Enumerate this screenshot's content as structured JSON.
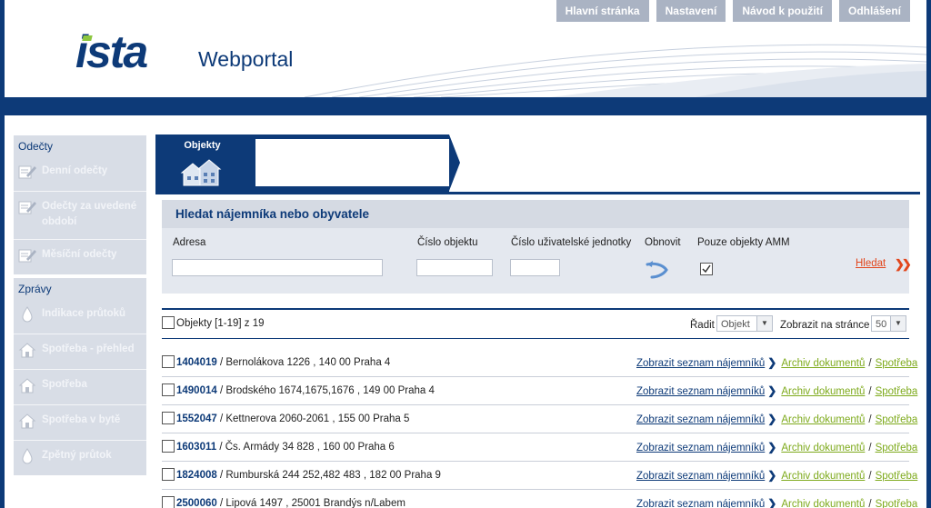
{
  "header": {
    "logo_text": "ista",
    "product": "Webportal",
    "nav": [
      "Hlavní stránka",
      "Nastavení",
      "Návod k použití",
      "Odhlášení"
    ]
  },
  "sidebar": {
    "groups": [
      {
        "title": "Odečty",
        "items": [
          {
            "label": "Denní odečty",
            "icon": "pencil-icon"
          },
          {
            "label": "Odečty za uvedené období",
            "icon": "pencil-icon"
          },
          {
            "label": "Měsíční odečty",
            "icon": "pencil-icon"
          }
        ]
      },
      {
        "title": "Zprávy",
        "items": [
          {
            "label": "Indikace průtoků",
            "icon": "drop-icon"
          },
          {
            "label": "Spotřeba - přehled",
            "icon": "house-icon"
          },
          {
            "label": "Spotřeba",
            "icon": "house-icon"
          },
          {
            "label": "Spotřeba v bytě",
            "icon": "house-icon"
          },
          {
            "label": "Zpětný průtok",
            "icon": "drop-icon"
          }
        ]
      }
    ]
  },
  "tab": {
    "label": "Objekty",
    "icon": "buildings-icon"
  },
  "search": {
    "title": "Hledat nájemníka nebo obyvatele",
    "fields": {
      "adresa": {
        "label": "Adresa",
        "value": ""
      },
      "cislo_objektu": {
        "label": "Číslo objektu",
        "value": ""
      },
      "cislo_jednotky": {
        "label": "Číslo uživatelské jednotky",
        "value": ""
      }
    },
    "refresh_label": "Obnovit",
    "amm_label": "Pouze objekty AMM",
    "amm_checked": true,
    "search_button": "Hledat"
  },
  "list": {
    "count_text": "Objekty [1-19] z 19",
    "sort_label": "Řadit",
    "sort_value": "Objekt",
    "page_size_label": "Zobrazit na stránce",
    "page_size_value": "50",
    "action_labels": {
      "tenants": "Zobrazit seznam nájemníků",
      "archive": "Archiv dokumentů",
      "consumption": "Spotřeba",
      "separator": "/"
    },
    "rows": [
      {
        "id": "1404019",
        "address": " / Bernolákova 1226 , 140 00 Praha 4"
      },
      {
        "id": "1490014",
        "address": " / Brodského 1674,1675,1676 , 149 00 Praha 4"
      },
      {
        "id": "1552047",
        "address": " / Kettnerova 2060-2061 , 155 00 Praha 5"
      },
      {
        "id": "1603011",
        "address": " / Čs. Armády 34 828 , 160 00 Praha 6"
      },
      {
        "id": "1824008",
        "address": " / Rumburská 244 252,482 483 , 182 00 Praha 9"
      },
      {
        "id": "2500060",
        "address": " / Lipová 1497 , 25001 Brandýs n/Labem"
      }
    ]
  },
  "colors": {
    "brand_navy": "#0d3a78",
    "link_green": "#7eaa1c",
    "search_red": "#e2461c",
    "topnav_gray": "#aab3c3"
  }
}
